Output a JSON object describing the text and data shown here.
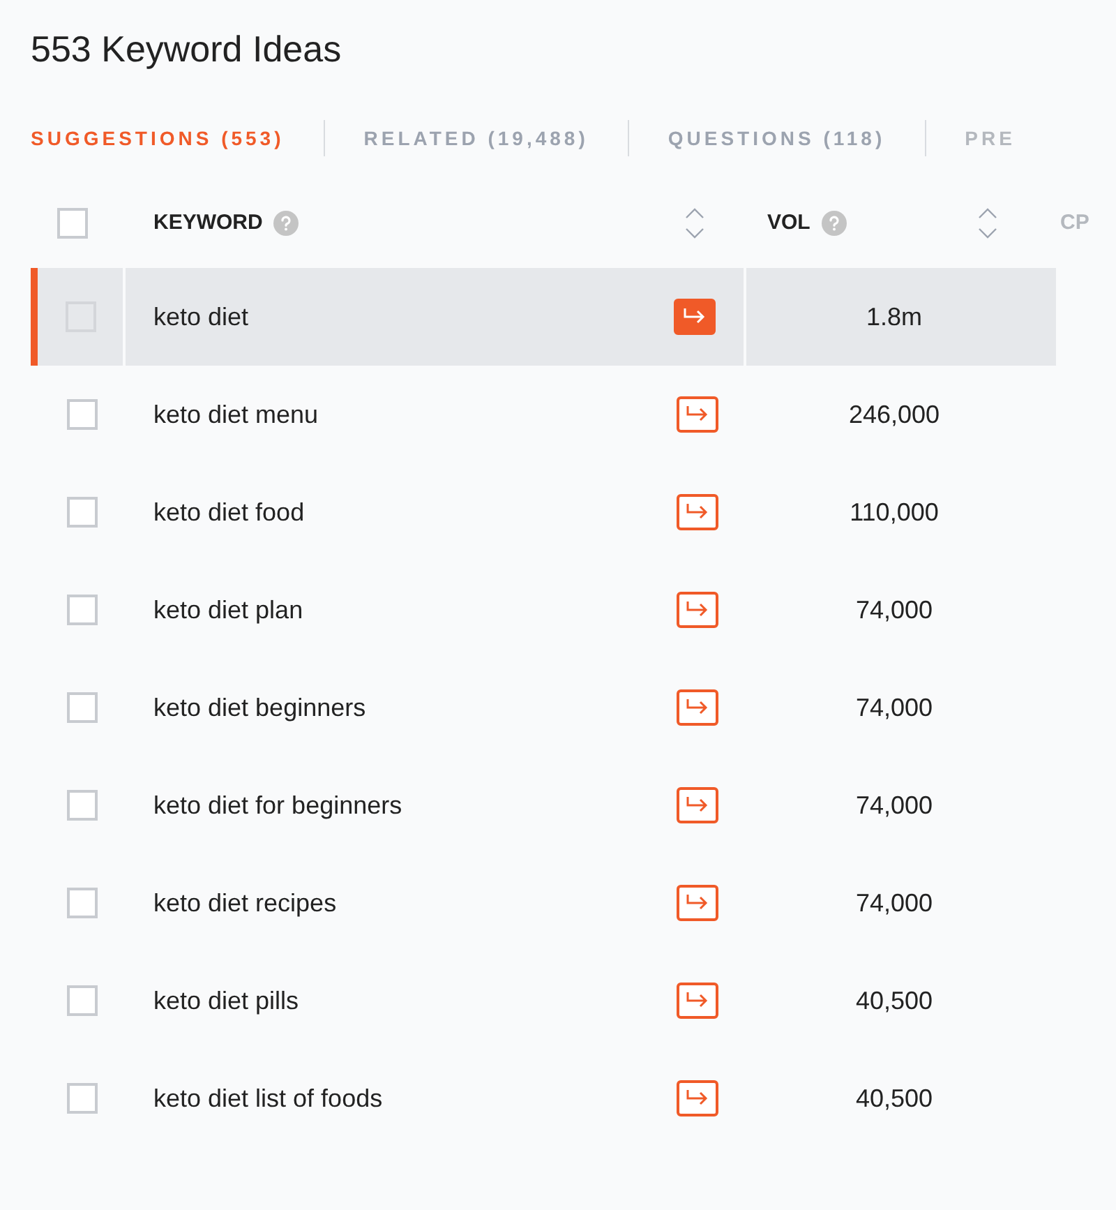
{
  "title": "553 Keyword Ideas",
  "tabs": [
    {
      "label": "SUGGESTIONS (553)",
      "selected": true
    },
    {
      "label": "RELATED (19,488)",
      "selected": false
    },
    {
      "label": "QUESTIONS (118)",
      "selected": false
    },
    {
      "label": "PRE",
      "selected": false
    }
  ],
  "table": {
    "select_all": {
      "checked": false
    },
    "columns": [
      {
        "label": "KEYWORD"
      },
      {
        "label": "VOL"
      },
      {
        "label": "CP"
      }
    ],
    "rows": [
      {
        "keyword": "keto diet",
        "volume": "1.8m",
        "selected": true,
        "checked": false
      },
      {
        "keyword": "keto diet menu",
        "volume": "246,000",
        "selected": false,
        "checked": false
      },
      {
        "keyword": "keto diet food",
        "volume": "110,000",
        "selected": false,
        "checked": false
      },
      {
        "keyword": "keto diet plan",
        "volume": "74,000",
        "selected": false,
        "checked": false
      },
      {
        "keyword": "keto diet beginners",
        "volume": "74,000",
        "selected": false,
        "checked": false
      },
      {
        "keyword": "keto diet for beginners",
        "volume": "74,000",
        "selected": false,
        "checked": false
      },
      {
        "keyword": "keto diet recipes",
        "volume": "74,000",
        "selected": false,
        "checked": false
      },
      {
        "keyword": "keto diet pills",
        "volume": "40,500",
        "selected": false,
        "checked": false
      },
      {
        "keyword": "keto diet list of foods",
        "volume": "40,500",
        "selected": false,
        "checked": false
      }
    ]
  }
}
